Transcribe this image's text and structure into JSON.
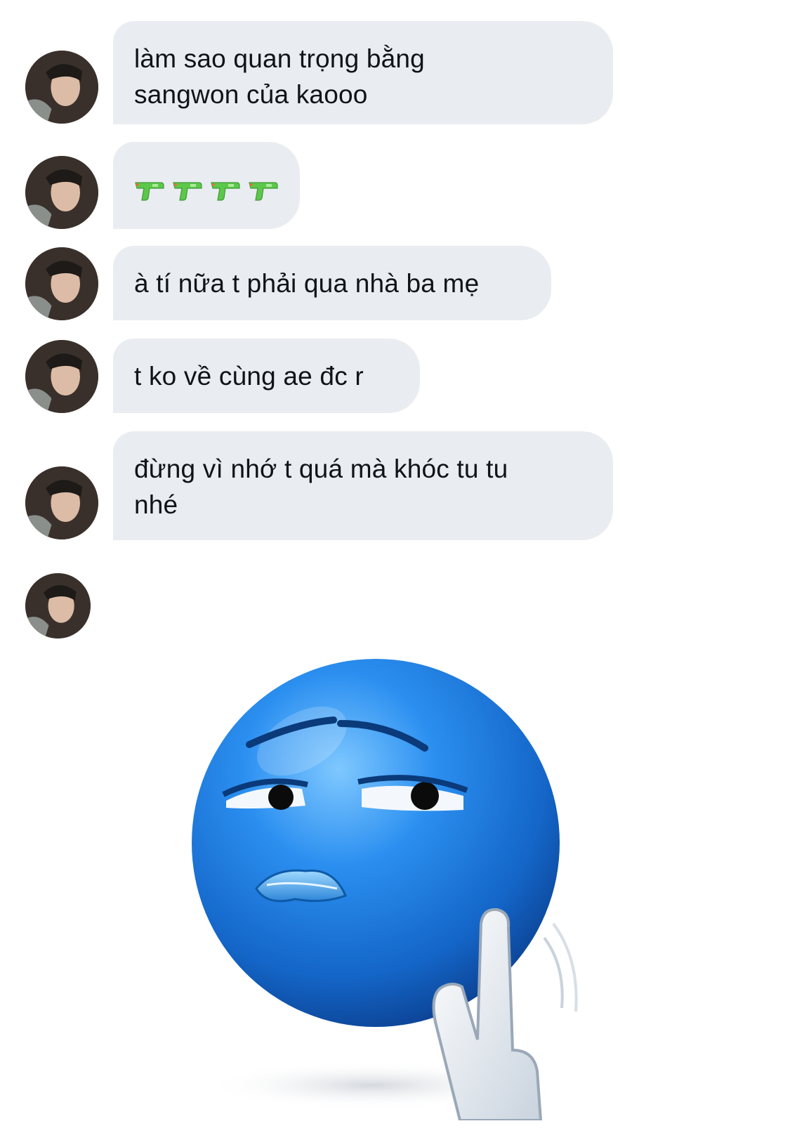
{
  "messages": [
    {
      "text": "làm sao quan trọng bằng\nsangwon của kaooo"
    },
    {
      "emoji": "water-pistol",
      "count": 4
    },
    {
      "text": "à tí nữa t phải qua nhà ba mẹ"
    },
    {
      "text": "t ko về cùng ae đc r"
    },
    {
      "text": "đừng vì nhớ t quá mà khóc tu tu\nnhé"
    }
  ],
  "sticker": {
    "icon": "sad-blue-smiley-shush-sticker"
  },
  "colors": {
    "bubble": "#e9ecf0",
    "text": "#101318",
    "sticker_blue": "#1e7fd8"
  }
}
